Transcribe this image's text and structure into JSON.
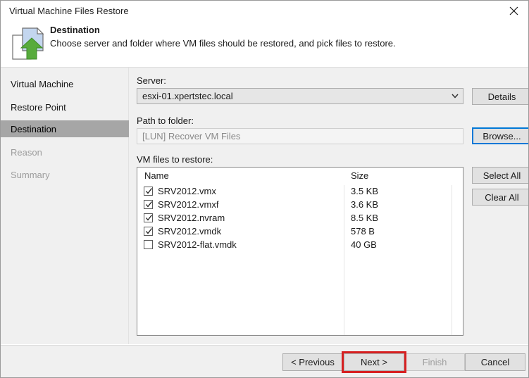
{
  "window": {
    "title": "Virtual Machine Files Restore",
    "close_icon": "close-icon"
  },
  "header": {
    "icon": "restore-files-icon",
    "title": "Destination",
    "subtitle": "Choose server and folder where VM files should be restored, and pick files to restore."
  },
  "sidebar": {
    "items": [
      {
        "label": "Virtual Machine",
        "state": "normal"
      },
      {
        "label": "Restore Point",
        "state": "normal"
      },
      {
        "label": "Destination",
        "state": "selected"
      },
      {
        "label": "Reason",
        "state": "disabled"
      },
      {
        "label": "Summary",
        "state": "disabled"
      }
    ]
  },
  "main": {
    "server_label": "Server:",
    "server_value": "esxi-01.xpertstec.local",
    "server_dropdown_icon": "chevron-down-icon",
    "details_button": "Details",
    "path_label": "Path to folder:",
    "path_placeholder": "[LUN] Recover VM Files",
    "browse_button": "Browse...",
    "files_label": "VM files to restore:",
    "select_all_button": "Select All",
    "clear_all_button": "Clear All",
    "columns": [
      "Name",
      "Size"
    ],
    "files": [
      {
        "name": "SRV2012.vmx",
        "size": "3.5 KB",
        "checked": true
      },
      {
        "name": "SRV2012.vmxf",
        "size": "3.6 KB",
        "checked": true
      },
      {
        "name": "SRV2012.nvram",
        "size": "8.5 KB",
        "checked": true
      },
      {
        "name": "SRV2012.vmdk",
        "size": "578 B",
        "checked": true
      },
      {
        "name": "SRV2012-flat.vmdk",
        "size": "40 GB",
        "checked": false
      }
    ]
  },
  "footer": {
    "previous_button": "< Previous",
    "next_button": "Next >",
    "finish_button": "Finish",
    "cancel_button": "Cancel"
  },
  "colors": {
    "accent": "#0078d7",
    "annotation": "#d62021",
    "selected_sidebar": "#a6a6a6",
    "icon_green": "#57ab3c"
  }
}
